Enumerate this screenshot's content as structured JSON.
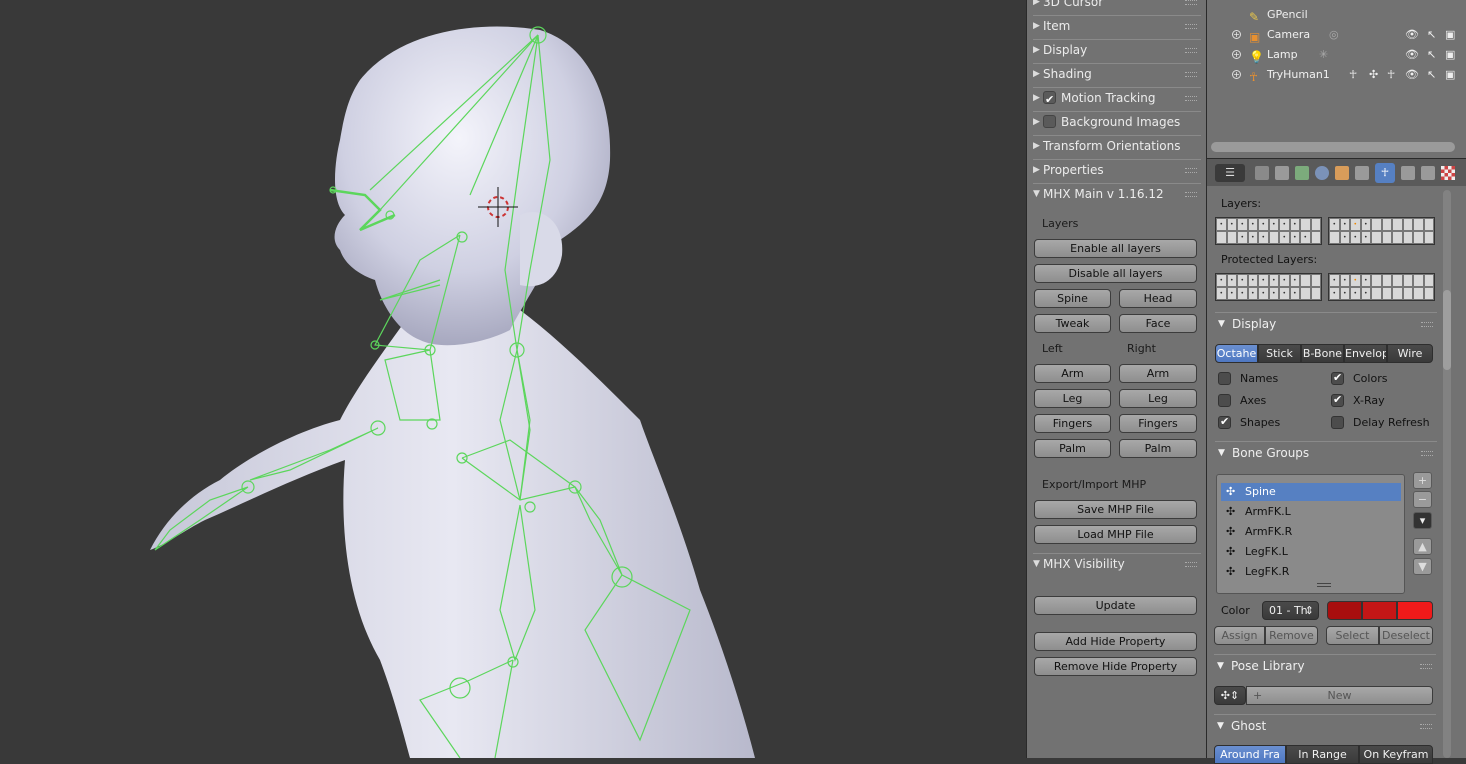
{
  "viewport": {
    "label": "3D Viewport"
  },
  "npanel": {
    "headers": [
      {
        "label": "3D Cursor",
        "open": false
      },
      {
        "label": "Item",
        "open": false
      },
      {
        "label": "Display",
        "open": false
      },
      {
        "label": "Shading",
        "open": false
      },
      {
        "label": "Motion Tracking",
        "open": false,
        "checkbox": true
      },
      {
        "label": "Background Images",
        "open": false,
        "checkbox": false
      },
      {
        "label": "Transform Orientations",
        "open": false
      },
      {
        "label": "Properties",
        "open": false
      },
      {
        "label": "MHX Main v 1.16.12",
        "open": true
      }
    ],
    "layers_label": "Layers",
    "enable_all": "Enable all layers",
    "disable_all": "Disable all layers",
    "spine": "Spine",
    "head": "Head",
    "tweak": "Tweak",
    "face": "Face",
    "left": "Left",
    "right": "Right",
    "arm_l": "Arm",
    "arm_r": "Arm",
    "leg_l": "Leg",
    "leg_r": "Leg",
    "fingers_l": "Fingers",
    "fingers_r": "Fingers",
    "palm_l": "Palm",
    "palm_r": "Palm",
    "export_label": "Export/Import MHP",
    "save_mhp": "Save MHP File",
    "load_mhp": "Load MHP File",
    "visibility_header": "MHX Visibility",
    "update": "Update",
    "add_hide": "Add Hide Property",
    "remove_hide": "Remove Hide Property"
  },
  "outliner": {
    "rows": [
      {
        "name": "GPencil",
        "icon": "pencil-icon"
      },
      {
        "name": "Camera",
        "icon": "camera-icon"
      },
      {
        "name": "Lamp",
        "icon": "lamp-icon"
      },
      {
        "name": "TryHuman1",
        "icon": "armature-icon"
      }
    ]
  },
  "properties": {
    "layers_label": "Layers:",
    "protected_label": "Protected Layers:",
    "display_header": "Display",
    "display_modes": [
      "Octahe",
      "Stick",
      "B-Bone",
      "Envelop",
      "Wire"
    ],
    "display_active": 0,
    "checks": [
      {
        "label": "Names",
        "on": false
      },
      {
        "label": "Colors",
        "on": true
      },
      {
        "label": "Axes",
        "on": false
      },
      {
        "label": "X-Ray",
        "on": true
      },
      {
        "label": "Shapes",
        "on": true
      },
      {
        "label": "Delay Refresh",
        "on": false
      }
    ],
    "bone_groups_header": "Bone Groups",
    "bone_groups": [
      "Spine",
      "ArmFK.L",
      "ArmFK.R",
      "LegFK.L",
      "LegFK.R"
    ],
    "bone_group_selected": 0,
    "color_label": "Color",
    "color_value": "01 - Th",
    "color_swatches": [
      "#a80e0e",
      "#c41616",
      "#f01a1a"
    ],
    "assign": "Assign",
    "remove": "Remove",
    "select": "Select",
    "deselect": "Deselect",
    "pose_library_header": "Pose Library",
    "new_label": "New",
    "ghost_header": "Ghost",
    "ghost_modes": [
      "Around Fra",
      "In Range",
      "On Keyfram"
    ]
  },
  "colors": {
    "accent": "#5680c2",
    "rig": "#5cd65c"
  }
}
